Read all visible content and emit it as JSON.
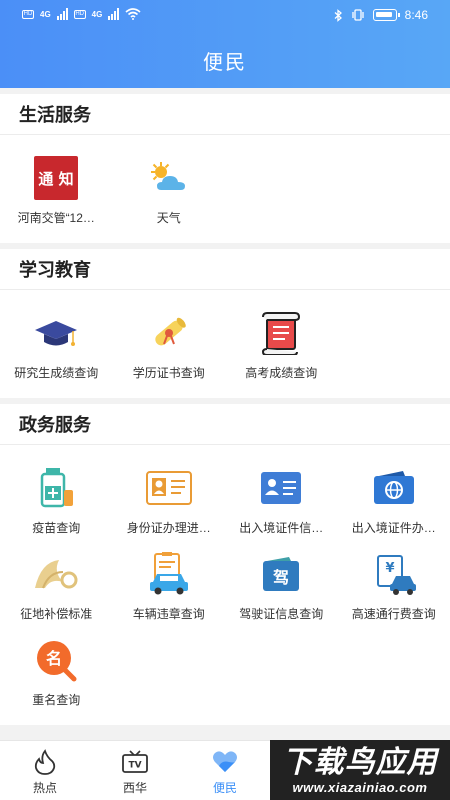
{
  "status_bar": {
    "sim1": "HD",
    "net1": "4G",
    "sim2": "HD",
    "net2": "4G",
    "time": "8:46"
  },
  "header": {
    "title": "便民"
  },
  "sections": [
    {
      "title": "生活服务",
      "items": [
        {
          "label": "河南交管“12…",
          "icon": "notice-icon",
          "icon_text": "通 知"
        },
        {
          "label": "天气",
          "icon": "weather-icon"
        }
      ]
    },
    {
      "title": "学习教育",
      "items": [
        {
          "label": "研究生成绩查询",
          "icon": "graduation-cap-icon"
        },
        {
          "label": "学历证书查询",
          "icon": "diploma-icon"
        },
        {
          "label": "高考成绩查询",
          "icon": "scroll-icon"
        }
      ]
    },
    {
      "title": "政务服务",
      "items": [
        {
          "label": "疫苗查询",
          "icon": "vaccine-icon"
        },
        {
          "label": "身份证办理进…",
          "icon": "id-card-icon"
        },
        {
          "label": "出入境证件信…",
          "icon": "entry-exit-card-icon"
        },
        {
          "label": "出入境证件办…",
          "icon": "passport-icon"
        },
        {
          "label": "征地补偿标准",
          "icon": "land-icon"
        },
        {
          "label": "车辆违章查询",
          "icon": "car-violation-icon"
        },
        {
          "label": "驾驶证信息查询",
          "icon": "driver-license-icon",
          "icon_text": "驾"
        },
        {
          "label": "高速通行费查询",
          "icon": "toll-icon",
          "icon_text": "¥"
        },
        {
          "label": "重名查询",
          "icon": "name-search-icon",
          "icon_text": "名"
        }
      ]
    }
  ],
  "tabbar": {
    "tabs": [
      {
        "label": "热点",
        "icon": "flame-icon"
      },
      {
        "label": "西华",
        "icon": "tv-icon",
        "icon_text": "TV"
      },
      {
        "label": "便民",
        "icon": "heart-icon",
        "active": true
      }
    ]
  },
  "watermark": {
    "main": "下载鸟应用",
    "sub": "www.xiazainiao.com"
  },
  "colors": {
    "accent": "#3b8ff7",
    "header_start": "#4b8ff7",
    "header_end": "#58a7f6"
  }
}
